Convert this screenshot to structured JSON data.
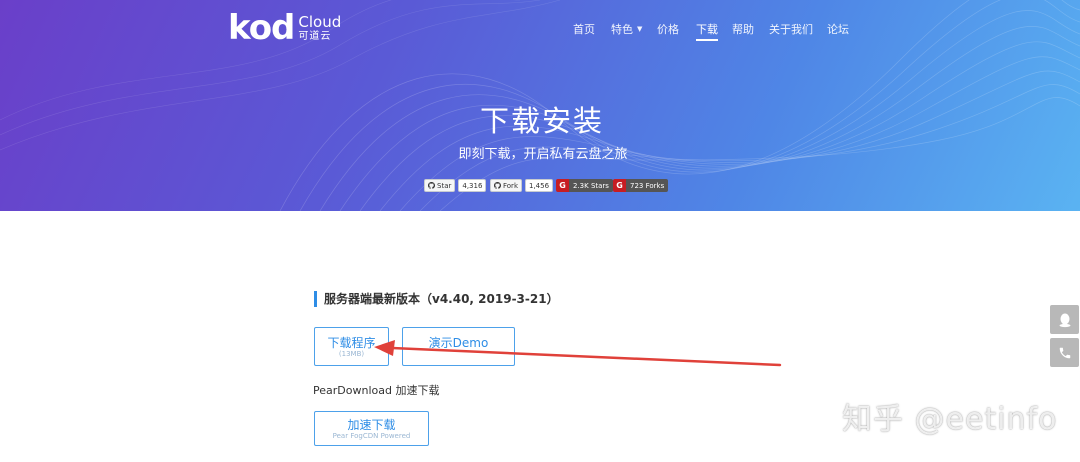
{
  "logo": {
    "brand": "kod",
    "cloud": "Cloud",
    "cn": "可道云"
  },
  "nav": {
    "items": [
      {
        "label": "首页"
      },
      {
        "label": "特色"
      },
      {
        "label": "价格"
      },
      {
        "label": "下载"
      },
      {
        "label": "帮助"
      },
      {
        "label": "关于我们"
      },
      {
        "label": "论坛"
      }
    ],
    "active": "下载"
  },
  "hero": {
    "title": "下载安装",
    "subtitle": "即刻下载，开启私有云盘之旅"
  },
  "badges": {
    "github_star": {
      "label": "Star",
      "count": "4,316"
    },
    "github_fork": {
      "label": "Fork",
      "count": "1,456"
    },
    "gitee_stars": {
      "logo": "G",
      "label": "2.3K Stars"
    },
    "gitee_forks": {
      "logo": "G",
      "label": "723 Forks"
    }
  },
  "server": {
    "section_title": "服务器端最新版本（v4.40, 2019-3-21）",
    "download_button": {
      "label": "下载程序",
      "size": "(13MB)"
    },
    "demo_button": {
      "label": "演示Demo",
      "sub": ""
    },
    "pear_label": "PearDownload 加速下载",
    "accel_button": {
      "label": "加速下载",
      "sub": "Pear FogCDN Powered"
    }
  },
  "watermark": "知乎 @eetinfo",
  "colors": {
    "accent": "#2e8de6",
    "hero_start": "#6a3fc9",
    "hero_end": "#5ab3f2",
    "annotation_arrow": "#e0413a",
    "gitee_red": "#c71d23"
  },
  "icons": {
    "github": "github-icon",
    "gitee": "gitee-icon",
    "qq": "qq-icon",
    "phone": "phone-icon",
    "caret": "caret-down-icon"
  }
}
